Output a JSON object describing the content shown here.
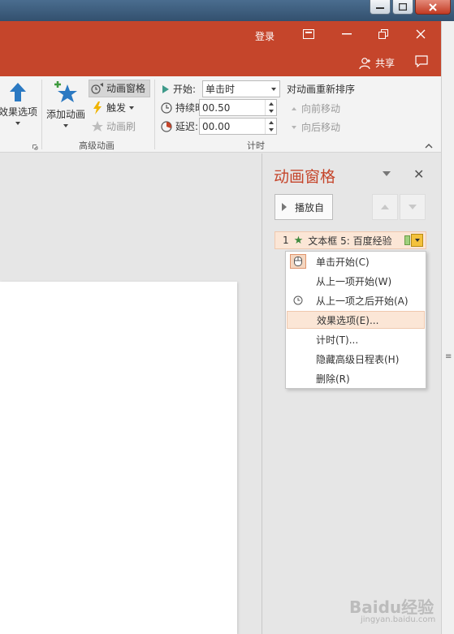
{
  "titlebar": {
    "login": "登录"
  },
  "share": {
    "label": "共享"
  },
  "ribbon": {
    "effect_options": "效果选项",
    "add_animation": "添加动画",
    "animation_pane": "动画窗格",
    "trigger": "触发",
    "animation_painter": "动画刷",
    "group_advanced": "高级动画",
    "start_label": "开始:",
    "start_value": "单击时",
    "duration_label": "持续时间:",
    "duration_value": "00.50",
    "delay_label": "延迟:",
    "delay_value": "00.00",
    "group_timing": "计时",
    "reorder_title": "对动画重新排序",
    "move_earlier": "向前移动",
    "move_later": "向后移动"
  },
  "pane": {
    "title": "动画窗格",
    "play_from": "播放自",
    "item": {
      "num": "1",
      "label": "文本框 5: 百度经验"
    }
  },
  "context_menu": {
    "items": [
      {
        "label": "单击开始(C)"
      },
      {
        "label": "从上一项开始(W)"
      },
      {
        "label": "从上一项之后开始(A)"
      },
      {
        "label": "效果选项(E)..."
      },
      {
        "label": "计时(T)..."
      },
      {
        "label": "隐藏高级日程表(H)"
      },
      {
        "label": "删除(R)"
      }
    ]
  },
  "watermark": {
    "logo": "Baidu经验",
    "sub": "jingyan.baidu.com"
  },
  "colors": {
    "accent": "#c5452b",
    "highlight": "#fbe6d6"
  }
}
